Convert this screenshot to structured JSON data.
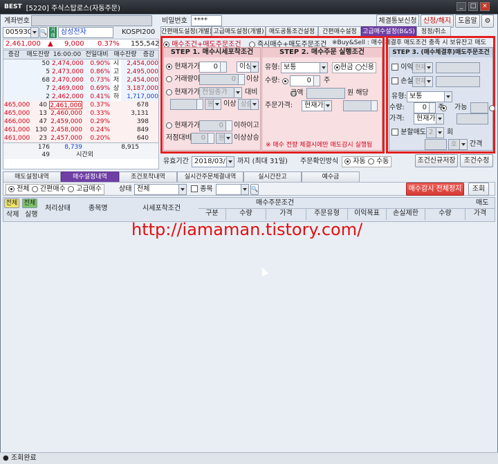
{
  "window": {
    "logo": "BEST",
    "title": "[5220] 주식스탑로스(자동주문)"
  },
  "account": {
    "label": "계좌번호",
    "password_label": "비밀번호",
    "password_value": "****"
  },
  "header_buttons": {
    "notice": "체결통보신청",
    "apply": "신청/해지",
    "help": "도움말"
  },
  "stock": {
    "code": "005930",
    "market_badge": "거래",
    "name": "삼성전자",
    "index_label": "KOSPI200",
    "price": "2,461,000",
    "arrow": "▲",
    "change": "9,000",
    "rate": "0.37%",
    "volume": "155,542"
  },
  "quote_header": {
    "h1": "증감",
    "h2": "매도잔량",
    "h3": "16:00:00",
    "h4": "전일대비",
    "h5": "매수잔량",
    "h6": "증감"
  },
  "ask_rows": [
    {
      "qty": "50",
      "price": "2,474,000",
      "rate": "0.90%"
    },
    {
      "qty": "5",
      "price": "2,473,000",
      "rate": "0.86%"
    },
    {
      "qty": "68",
      "price": "2,470,000",
      "rate": "0.73%"
    },
    {
      "qty": "7",
      "price": "2,469,000",
      "rate": "0.69%"
    },
    {
      "qty": "2",
      "price": "2,462,000",
      "rate": "0.41%"
    }
  ],
  "bid_rows": [
    {
      "chg": "465,000",
      "qty": "40",
      "price": "2,461,000",
      "rate": "0.37%",
      "bqty": "678"
    },
    {
      "chg": "465,000",
      "qty": "13",
      "price": "2,460,000",
      "rate": "0.33%",
      "bqty": "3,131"
    },
    {
      "chg": "466,000",
      "qty": "47",
      "price": "2,459,000",
      "rate": "0.29%",
      "bqty": "398"
    },
    {
      "chg": "461,000",
      "qty": "130",
      "price": "2,458,000",
      "rate": "0.24%",
      "bqty": "849"
    },
    {
      "chg": "461,000",
      "qty": "23",
      "price": "2,457,000",
      "rate": "0.20%",
      "bqty": "640"
    }
  ],
  "side_info": [
    {
      "k": "시",
      "v": "2,454,000"
    },
    {
      "k": "고",
      "v": "2,495,000"
    },
    {
      "k": "저",
      "v": "2,454,000"
    },
    {
      "k": "상",
      "v": "3,187,000"
    },
    {
      "k": "하",
      "v": "1,717,000"
    }
  ],
  "quote_totals": {
    "ask_total": "176",
    "sum": "8,739",
    "bid_total": "8,915",
    "extra": "49",
    "time_label": "시간외"
  },
  "top_tabs": [
    "간편매도설정(개별)",
    "고급매도설정(개별)",
    "매도공통조건설정",
    "간편매수설정",
    "고급매수설정(B&S)",
    "정정/취소"
  ],
  "mode": {
    "opt1": "매수조건+매도주문조건",
    "opt2": "즉시매수+매도주문조건",
    "note": "※Buy&Sell : 매수 체결후 매도조건 충족 시 보유잔고 매도"
  },
  "step1": {
    "title": "STEP 1. 매수시세포착조건",
    "r1": "현재가가",
    "r1_val": "0",
    "r1_sel": "이상",
    "r2": "거래량이",
    "r2_val": "0",
    "r2_suffix": "이상",
    "r3": "현재가가",
    "r3_sel": "전일종가",
    "r3_suffix": "대비",
    "r3_unit": "원",
    "r3_cond": "이상",
    "r3_dir": "상승",
    "r4": "현재가가",
    "r4_val": "0",
    "r4_suffix": "이하이고",
    "r5": "저점대비",
    "r5_val": "0",
    "r5_unit": "원",
    "r5_suffix": "이상상승"
  },
  "step2": {
    "title": "STEP 2. 매수주문 실행조건",
    "type_label": "유형:",
    "type_val": "보통",
    "cash": "현금",
    "credit": "신용",
    "qty_label": "수량:",
    "qty_val": "0",
    "qty_unit": "주",
    "amount_label": "금액",
    "amount_suffix": "원 해당",
    "price_label": "주문가격:",
    "price_val": "현재가",
    "warning": "※ 매수 전량 체결시에만 매도감시 실행됨"
  },
  "step3": {
    "title": "STEP 3. (매수체결후)매도주문조건",
    "profit": "이익",
    "loss": "손실",
    "sel_cur": "현재",
    "type_label": "유형:",
    "type_val": "보통",
    "qty_label": "수량:",
    "qty_val": "0",
    "qty_unit": "주",
    "avail": "가능",
    "price_label": "가격:",
    "price_val": "현재가",
    "split": "분할매도",
    "split_val": "2",
    "split_unit": "회",
    "interval": "간격",
    "tick": "호"
  },
  "validity": {
    "label": "유효기간",
    "date": "2018/03/31",
    "suffix": "까지 (최대 31일)",
    "confirm_label": "주문확인방식",
    "auto": "자동",
    "manual": "수동",
    "save_btn": "조건신규저장",
    "edit_btn": "조건수정"
  },
  "bottom_tabs": [
    "매도설정내역",
    "매수설정내역",
    "조건포착내역",
    "실시간주문체결내역",
    "실시간잔고",
    "예수금"
  ],
  "filter": {
    "all": "전체",
    "simple": "간편매수",
    "advanced": "고급매수",
    "status_label": "상태",
    "status_val": "전체",
    "stock_label": "종목",
    "stop_btn": "매수감시 전체정지",
    "query_btn": "조회"
  },
  "grid": {
    "all_btn": "전체",
    "all_btn2": "전체",
    "delete": "삭제",
    "execute": "실행",
    "state": "처리상태",
    "name": "종목명",
    "cond": "시세포착조건",
    "buy_group": "매수주문조건",
    "sell_group": "매도",
    "sub": [
      "구분",
      "수량",
      "가격",
      "주문유형",
      "이익목표",
      "손실제한",
      "수량",
      "가격"
    ]
  },
  "watermark": "http://iamaman.tistory.com/",
  "status": {
    "text": "조회완료"
  },
  "colors": {
    "accent": "#6f3fa5",
    "highlight": "#e41e1e",
    "up": "#d0021b",
    "down": "#1a3fd6"
  }
}
